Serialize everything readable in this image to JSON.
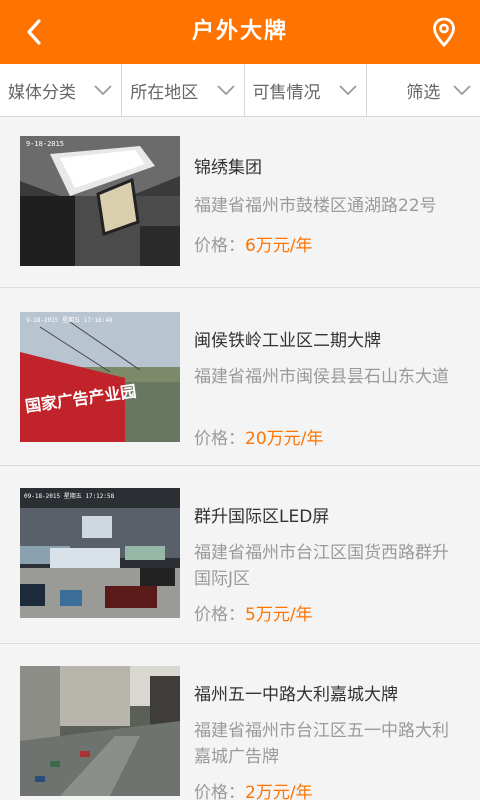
{
  "header": {
    "title": "户外大牌",
    "back_icon": "chevron-left-icon",
    "location_icon": "map-pin-icon",
    "accent": "#ff7400"
  },
  "filters": [
    {
      "label": "媒体分类"
    },
    {
      "label": "所在地区"
    },
    {
      "label": "可售情况"
    },
    {
      "label": "筛选"
    }
  ],
  "list": {
    "price_label": "价格：",
    "items": [
      {
        "name": "锦绣集团",
        "address": "福建省福州市鼓楼区通湖路22号",
        "price": "6万元/年",
        "cam_stamp": "9-18-2015"
      },
      {
        "name": "闽侯铁岭工业区二期大牌",
        "address": "福建省福州市闽侯县昙石山东大道",
        "price": "20万元/年",
        "cam_stamp": "9-18-2015 星期五 17:16:48",
        "billboard_text": "国家广告产业园"
      },
      {
        "name": "群升国际区LED屏",
        "address": "福建省福州市台江区国货西路群升国际J区",
        "price": "5万元/年",
        "cam_stamp": "09-18-2015 星期五 17:12:58"
      },
      {
        "name": "福州五一中路大利嘉城大牌",
        "address": "福建省福州市台江区五一中路大利嘉城广告牌",
        "price": "2万元/年",
        "cam_stamp": ""
      }
    ]
  }
}
